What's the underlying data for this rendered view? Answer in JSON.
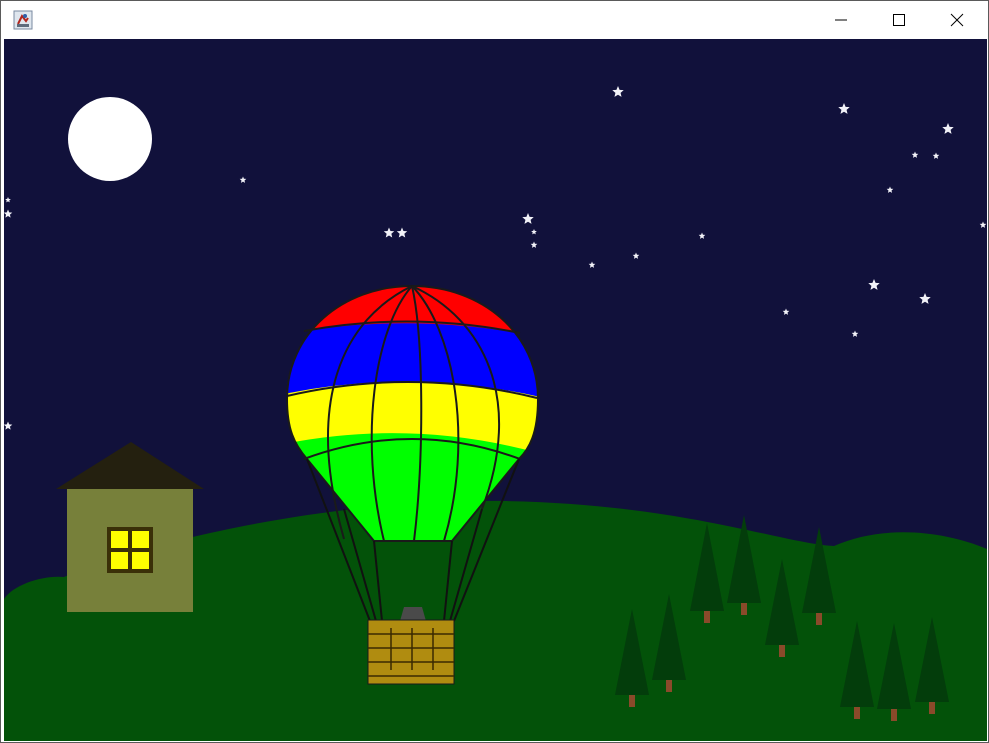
{
  "window": {
    "title": "",
    "controls": {
      "minimize_icon": "minimize-icon",
      "maximize_icon": "maximize-icon",
      "close_icon": "close-icon"
    }
  },
  "scene": {
    "sky_color": "#11113b",
    "hill_color": "#035209",
    "moon_color": "#ffffff",
    "star_color": "#f2f2f8",
    "house": {
      "wall_color": "#77803a",
      "roof_color": "#24200f",
      "window_color": "#ffff00",
      "window_frame_color": "#3a3008"
    },
    "balloon": {
      "stripe_colors": [
        "#ff0000",
        "#0000ff",
        "#ffff00",
        "#00ff00"
      ],
      "basket_color": "#b08c10",
      "burner_color": "#4a4a4a"
    },
    "tree": {
      "foliage_color": "#033d0b",
      "trunk_color": "#8a4a2a"
    }
  }
}
